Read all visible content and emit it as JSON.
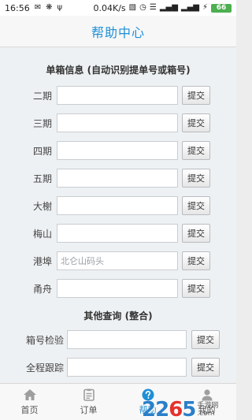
{
  "status_bar": {
    "time": "16:56",
    "net_speed": "0.04K/s",
    "battery": "66"
  },
  "header": {
    "title": "帮助中心"
  },
  "section1": {
    "title": "单箱信息 (自动识别提单号或箱号)",
    "rows": [
      {
        "label": "二期",
        "value": "",
        "placeholder": "",
        "button": "提交"
      },
      {
        "label": "三期",
        "value": "",
        "placeholder": "",
        "button": "提交"
      },
      {
        "label": "四期",
        "value": "",
        "placeholder": "",
        "button": "提交"
      },
      {
        "label": "五期",
        "value": "",
        "placeholder": "",
        "button": "提交"
      },
      {
        "label": "大榭",
        "value": "",
        "placeholder": "",
        "button": "提交"
      },
      {
        "label": "梅山",
        "value": "",
        "placeholder": "",
        "button": "提交"
      },
      {
        "label": "港埠",
        "value": "",
        "placeholder": "北仑山码头",
        "button": "提交"
      },
      {
        "label": "甬舟",
        "value": "",
        "placeholder": "",
        "button": "提交"
      }
    ]
  },
  "section2": {
    "title": "其他查询 (整合)",
    "rows": [
      {
        "label": "箱号检验",
        "value": "",
        "placeholder": "",
        "button": "提交"
      },
      {
        "label": "全程跟踪",
        "value": "",
        "placeholder": "",
        "button": "提交"
      }
    ]
  },
  "bottom_nav": {
    "items": [
      {
        "label": "首页",
        "icon": "home-icon",
        "active": false
      },
      {
        "label": "订单",
        "icon": "order-icon",
        "active": false
      },
      {
        "label": "帮助",
        "icon": "help-icon",
        "active": true
      },
      {
        "label": "我的",
        "icon": "user-icon",
        "active": false
      }
    ]
  },
  "watermark": {
    "number_a": "22",
    "number_b": "6",
    "number_c": "5",
    "line1": "手游网",
    "line2": ".com"
  },
  "colors": {
    "accent": "#1f8fd6",
    "background": "#eef1f3",
    "battery": "#4caf50"
  }
}
